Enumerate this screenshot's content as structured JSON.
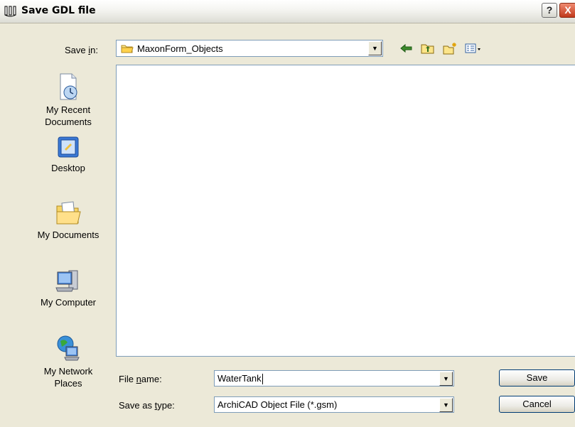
{
  "window": {
    "title": "Save GDL file",
    "help_button": "?",
    "close_button": "X"
  },
  "save_in": {
    "label_pre": "Save ",
    "label_accel": "i",
    "label_post": "n:",
    "value": "MaxonForm_Objects"
  },
  "toolbar": {
    "icons": [
      "back-icon",
      "up-folder-icon",
      "new-folder-icon",
      "view-menu-icon"
    ]
  },
  "places": [
    {
      "label_line1": "My Recent",
      "label_line2": "Documents",
      "icon": "recent-documents-icon"
    },
    {
      "label_line1": "Desktop",
      "label_line2": "",
      "icon": "desktop-icon"
    },
    {
      "label_line1": "My Documents",
      "label_line2": "",
      "icon": "my-documents-icon"
    },
    {
      "label_line1": "My Computer",
      "label_line2": "",
      "icon": "my-computer-icon"
    },
    {
      "label_line1": "My Network",
      "label_line2": "Places",
      "icon": "network-places-icon"
    }
  ],
  "file_name": {
    "label_pre": "File ",
    "label_accel": "n",
    "label_post": "ame:",
    "value": "WaterTank"
  },
  "save_as_type": {
    "label_pre": "Save as ",
    "label_accel": "t",
    "label_post": "ype:",
    "value": "ArchiCAD Object File (*.gsm)"
  },
  "buttons": {
    "save": "Save",
    "cancel": "Cancel"
  },
  "colors": {
    "dialog_bg": "#ece9d8",
    "field_border": "#7f9db9",
    "button_border": "#003c74"
  }
}
